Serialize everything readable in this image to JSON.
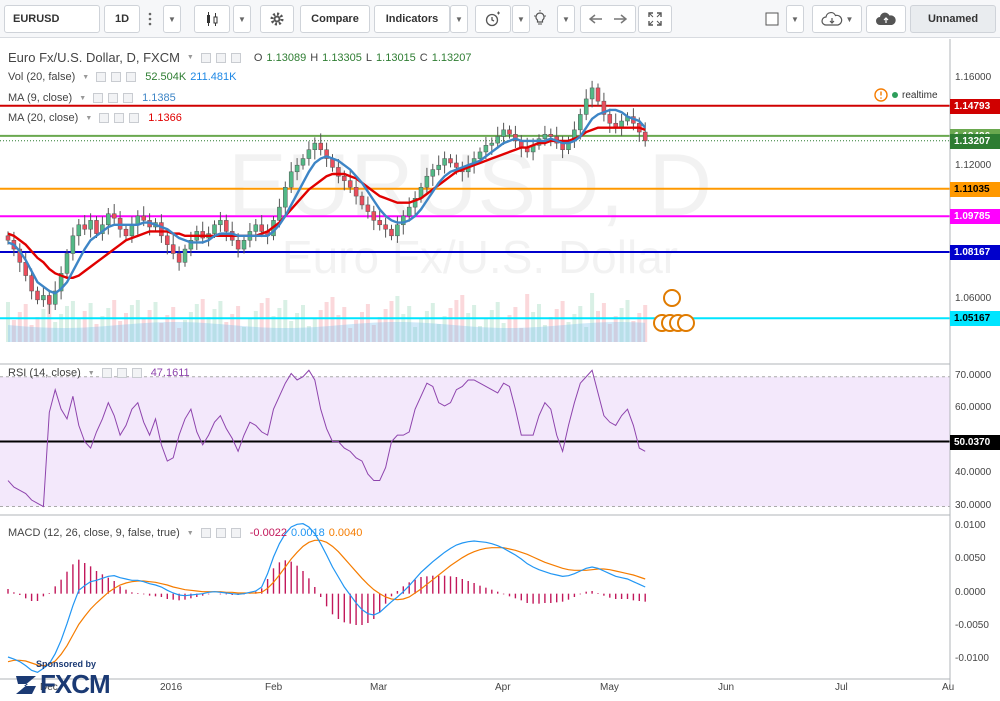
{
  "toolbar": {
    "symbol": "EURUSD",
    "interval": "1D",
    "compare": "Compare",
    "indicators": "Indicators",
    "layout_name": "Unnamed"
  },
  "main_legend": {
    "title": "Euro Fx/U.S. Dollar, D, FXCM",
    "o_label": "O",
    "o": "1.13089",
    "h_label": "H",
    "h": "1.13305",
    "l_label": "L",
    "l": "1.13015",
    "c_label": "C",
    "c": "1.13207",
    "realtime": "realtime"
  },
  "vol_legend": {
    "label": "Vol (20, false)",
    "v1": "52.504K",
    "v2": "211.481K"
  },
  "ma9_legend": {
    "label": "MA (9, close)",
    "value": "1.1385"
  },
  "ma20_legend": {
    "label": "MA (20, close)",
    "value": "1.1366"
  },
  "rsi_legend": {
    "label": "RSI (14, close)",
    "value": "47.1611"
  },
  "macd_legend": {
    "label": "MACD (12, 26, close, 9, false, true)",
    "v1": "-0.0022",
    "v2": "0.0018",
    "v3": "0.0040"
  },
  "watermark": {
    "line1": "EURUSD, D",
    "line2": "Euro Fx/U.S. Dollar"
  },
  "price_axis": {
    "ticks": [
      {
        "label": "1.16000",
        "value": 1.16
      },
      {
        "label": "1.12000",
        "value": 1.12
      },
      {
        "label": "1.06000",
        "value": 1.06
      }
    ],
    "labels": [
      {
        "label": "1.14793",
        "value": 1.14793,
        "color": "#d00000"
      },
      {
        "label": "1.13426",
        "value": 1.13426,
        "color": "#6aa84f"
      },
      {
        "label": "1.13207",
        "value": 1.13207,
        "color": "#2e7d32"
      },
      {
        "label": "1.11035",
        "value": 1.11035,
        "color": "#ff9900"
      },
      {
        "label": "1.09785",
        "value": 1.09785,
        "color": "#ff00ff"
      },
      {
        "label": "1.08167",
        "value": 1.08167,
        "color": "#0000cc"
      },
      {
        "label": "1.05167",
        "value": 1.05167,
        "color": "#00e5ff"
      }
    ]
  },
  "rsi_axis": {
    "ticks": [
      {
        "label": "70.0000",
        "value": 70
      },
      {
        "label": "60.0000",
        "value": 60
      },
      {
        "label": "40.0000",
        "value": 40
      },
      {
        "label": "30.0000",
        "value": 30
      }
    ],
    "marker": {
      "label": "50.0370",
      "value": 50.037
    }
  },
  "macd_axis": {
    "ticks": [
      {
        "label": "0.0100",
        "value": 0.01
      },
      {
        "label": "0.0050",
        "value": 0.005
      },
      {
        "label": "0.0000",
        "value": 0
      },
      {
        "label": "-0.0050",
        "value": -0.005
      },
      {
        "label": "-0.0100",
        "value": -0.01
      }
    ]
  },
  "time_axis": [
    "Dec",
    "2016",
    "Feb",
    "Mar",
    "Apr",
    "May",
    "Jun",
    "Jul",
    "Au"
  ],
  "sponsor": {
    "text": "Sponsored by",
    "brand": "FXCM"
  },
  "colors": {
    "up": "#53b987",
    "down": "#eb4d5c",
    "ma9": "#3d85c6",
    "ma20": "#e00000",
    "rsi": "#8e44ad",
    "macd": "#2196f3",
    "signal": "#f57c00",
    "hist": "#c2185b",
    "rsi_bg": "#f3e8fb"
  },
  "chart_data": [
    {
      "type": "candlestick",
      "title": "Euro Fx/U.S. Dollar, D, FXCM",
      "ylim": [
        1.04,
        1.17
      ],
      "horizontal_lines": [
        1.14793,
        1.13426,
        1.11035,
        1.09785,
        1.08167,
        1.05167
      ],
      "close": [
        1.087,
        1.083,
        1.077,
        1.071,
        1.064,
        1.06,
        1.062,
        1.058,
        1.064,
        1.072,
        1.081,
        1.089,
        1.094,
        1.092,
        1.096,
        1.09,
        1.094,
        1.099,
        1.097,
        1.092,
        1.089,
        1.094,
        1.098,
        1.096,
        1.093,
        1.095,
        1.089,
        1.085,
        1.081,
        1.077,
        1.083,
        1.087,
        1.091,
        1.088,
        1.09,
        1.094,
        1.096,
        1.091,
        1.087,
        1.083,
        1.087,
        1.091,
        1.094,
        1.091,
        1.089,
        1.096,
        1.102,
        1.111,
        1.118,
        1.121,
        1.124,
        1.128,
        1.131,
        1.128,
        1.124,
        1.12,
        1.116,
        1.114,
        1.111,
        1.107,
        1.103,
        1.1,
        1.096,
        1.094,
        1.092,
        1.089,
        1.094,
        1.098,
        1.102,
        1.106,
        1.111,
        1.116,
        1.119,
        1.121,
        1.124,
        1.122,
        1.12,
        1.118,
        1.121,
        1.124,
        1.127,
        1.13,
        1.131,
        1.134,
        1.137,
        1.135,
        1.132,
        1.129,
        1.127,
        1.13,
        1.133,
        1.135,
        1.134,
        1.131,
        1.128,
        1.132,
        1.137,
        1.144,
        1.151,
        1.156,
        1.15,
        1.144,
        1.14,
        1.138,
        1.141,
        1.143,
        1.14,
        1.136,
        1.132
      ],
      "ma9": [
        1.086,
        1.085,
        1.082,
        1.078,
        1.073,
        1.068,
        1.066,
        1.064,
        1.063,
        1.065,
        1.068,
        1.073,
        1.078,
        1.083,
        1.087,
        1.089,
        1.091,
        1.093,
        1.094,
        1.094,
        1.094,
        1.094,
        1.094,
        1.095,
        1.095,
        1.094,
        1.093,
        1.092,
        1.09,
        1.088,
        1.087,
        1.086,
        1.086,
        1.086,
        1.087,
        1.089,
        1.09,
        1.09,
        1.09,
        1.089,
        1.089,
        1.089,
        1.089,
        1.089,
        1.089,
        1.091,
        1.094,
        1.098,
        1.103,
        1.108,
        1.113,
        1.118,
        1.122,
        1.124,
        1.125,
        1.124,
        1.123,
        1.121,
        1.119,
        1.116,
        1.113,
        1.109,
        1.105,
        1.101,
        1.098,
        1.096,
        1.095,
        1.095,
        1.096,
        1.098,
        1.101,
        1.105,
        1.109,
        1.113,
        1.116,
        1.118,
        1.119,
        1.12,
        1.121,
        1.122,
        1.123,
        1.125,
        1.127,
        1.129,
        1.131,
        1.132,
        1.133,
        1.132,
        1.132,
        1.132,
        1.132,
        1.132,
        1.133,
        1.132,
        1.131,
        1.131,
        1.132,
        1.134,
        1.138,
        1.142,
        1.144,
        1.145,
        1.146,
        1.146,
        1.145,
        1.143,
        1.142,
        1.141,
        1.138
      ],
      "ma20": [
        1.09,
        1.089,
        1.087,
        1.085,
        1.082,
        1.079,
        1.077,
        1.074,
        1.072,
        1.071,
        1.07,
        1.07,
        1.071,
        1.073,
        1.075,
        1.077,
        1.079,
        1.081,
        1.083,
        1.085,
        1.087,
        1.088,
        1.089,
        1.09,
        1.091,
        1.091,
        1.091,
        1.091,
        1.09,
        1.09,
        1.089,
        1.089,
        1.089,
        1.089,
        1.089,
        1.089,
        1.089,
        1.089,
        1.089,
        1.089,
        1.089,
        1.089,
        1.089,
        1.09,
        1.091,
        1.093,
        1.095,
        1.098,
        1.101,
        1.104,
        1.107,
        1.11,
        1.112,
        1.114,
        1.116,
        1.117,
        1.117,
        1.117,
        1.116,
        1.115,
        1.113,
        1.111,
        1.109,
        1.107,
        1.106,
        1.105,
        1.104,
        1.104,
        1.104,
        1.105,
        1.106,
        1.108,
        1.11,
        1.112,
        1.114,
        1.116,
        1.118,
        1.119,
        1.12,
        1.121,
        1.122,
        1.123,
        1.124,
        1.125,
        1.126,
        1.127,
        1.128,
        1.129,
        1.129,
        1.13,
        1.131,
        1.131,
        1.132,
        1.132,
        1.132,
        1.132,
        1.133,
        1.134,
        1.136,
        1.137,
        1.138,
        1.138,
        1.138,
        1.138,
        1.138,
        1.138,
        1.138,
        1.138,
        1.137
      ]
    },
    {
      "type": "line",
      "title": "RSI (14, close)",
      "ylim": [
        28,
        73
      ],
      "values": [
        38,
        36,
        35,
        34,
        32,
        31,
        30,
        59,
        66,
        60,
        57,
        64,
        55,
        50,
        48,
        53,
        57,
        62,
        58,
        52,
        55,
        60,
        62,
        56,
        52,
        57,
        49,
        44,
        45,
        52,
        57,
        60,
        53,
        49,
        52,
        56,
        58,
        54,
        51,
        47,
        52,
        56,
        55,
        53,
        52,
        60,
        64,
        68,
        71,
        69,
        70,
        72,
        69,
        60,
        54,
        50,
        50,
        48,
        47,
        45,
        44,
        40,
        38,
        38,
        42,
        50,
        52,
        52,
        53,
        60,
        64,
        68,
        67,
        62,
        61,
        62,
        66,
        67,
        69,
        69,
        68,
        67,
        66,
        65,
        68,
        67,
        60,
        52,
        52,
        52,
        58,
        62,
        60,
        52,
        47,
        55,
        62,
        68,
        70,
        72,
        65,
        58,
        56,
        55,
        58,
        60,
        55,
        48,
        47
      ],
      "marker": 50.037
    },
    {
      "type": "line",
      "title": "MACD (12, 26, close, 9, false, true)",
      "ylim": [
        -0.0125,
        0.0115
      ],
      "macd": [
        -0.0095,
        -0.0098,
        -0.0102,
        -0.0108,
        -0.0115,
        -0.0118,
        -0.0112,
        -0.0105,
        -0.009,
        -0.007,
        -0.0045,
        -0.0018,
        0.0005,
        0.0012,
        0.0018,
        0.002,
        0.0023,
        0.0026,
        0.0027,
        0.0024,
        0.0022,
        0.002,
        0.002,
        0.0018,
        0.0015,
        0.0013,
        0.001,
        0.0005,
        0.0001,
        -0.0002,
        -0.0003,
        -0.0002,
        -0.0001,
        0.0,
        0.0002,
        0.0003,
        0.0002,
        0.0001,
        0.0,
        -0.0001,
        0.0,
        0.0002,
        0.0004,
        0.001,
        0.003,
        0.0055,
        0.0075,
        0.009,
        0.01,
        0.0104,
        0.0105,
        0.01,
        0.009,
        0.0075,
        0.0058,
        0.004,
        0.0025,
        0.001,
        -0.0002,
        -0.0014,
        -0.0024,
        -0.003,
        -0.0032,
        -0.0028,
        -0.002,
        -0.0012,
        -0.0005,
        0.0003,
        0.0012,
        0.0022,
        0.0032,
        0.004,
        0.0048,
        0.0055,
        0.0062,
        0.0068,
        0.0073,
        0.0076,
        0.0078,
        0.0079,
        0.0078,
        0.0077,
        0.0075,
        0.0072,
        0.0068,
        0.0063,
        0.0058,
        0.0052,
        0.0045,
        0.004,
        0.0036,
        0.0033,
        0.003,
        0.0028,
        0.0026,
        0.0027,
        0.003,
        0.0034,
        0.0038,
        0.004,
        0.0038,
        0.0034,
        0.003,
        0.0026,
        0.0024,
        0.0022,
        0.0018,
        0.0014,
        0.001
      ],
      "signal": [
        -0.0102,
        -0.01,
        -0.01,
        -0.0101,
        -0.0104,
        -0.0107,
        -0.0108,
        -0.0106,
        -0.0101,
        -0.0091,
        -0.0078,
        -0.0062,
        -0.0046,
        -0.0034,
        -0.0023,
        -0.0014,
        -0.0006,
        0.0002,
        0.0008,
        0.0013,
        0.0016,
        0.0018,
        0.0019,
        0.0019,
        0.0018,
        0.0017,
        0.0015,
        0.0013,
        0.001,
        0.0008,
        0.0006,
        0.0005,
        0.0004,
        0.0003,
        0.0003,
        0.0003,
        0.0003,
        0.0002,
        0.0002,
        0.0001,
        0.0001,
        0.0001,
        0.0001,
        0.0002,
        0.0008,
        0.0017,
        0.0028,
        0.004,
        0.0052,
        0.0062,
        0.0071,
        0.0077,
        0.008,
        0.008,
        0.0077,
        0.0071,
        0.0063,
        0.0053,
        0.0043,
        0.0033,
        0.0023,
        0.0014,
        0.0006,
        0.0,
        -0.0005,
        -0.0008,
        -0.0009,
        -0.0008,
        -0.0005,
        0.0001,
        0.0007,
        0.0014,
        0.0021,
        0.0028,
        0.0035,
        0.0042,
        0.0048,
        0.0054,
        0.0059,
        0.0063,
        0.0066,
        0.0068,
        0.0069,
        0.0069,
        0.0069,
        0.0067,
        0.0065,
        0.0062,
        0.0059,
        0.0055,
        0.0051,
        0.0047,
        0.0044,
        0.0041,
        0.0038,
        0.0036,
        0.0035,
        0.0035,
        0.0035,
        0.0036,
        0.0037,
        0.0037,
        0.0036,
        0.0034,
        0.0032,
        0.003,
        0.0028,
        0.0025,
        0.0022
      ]
    }
  ]
}
